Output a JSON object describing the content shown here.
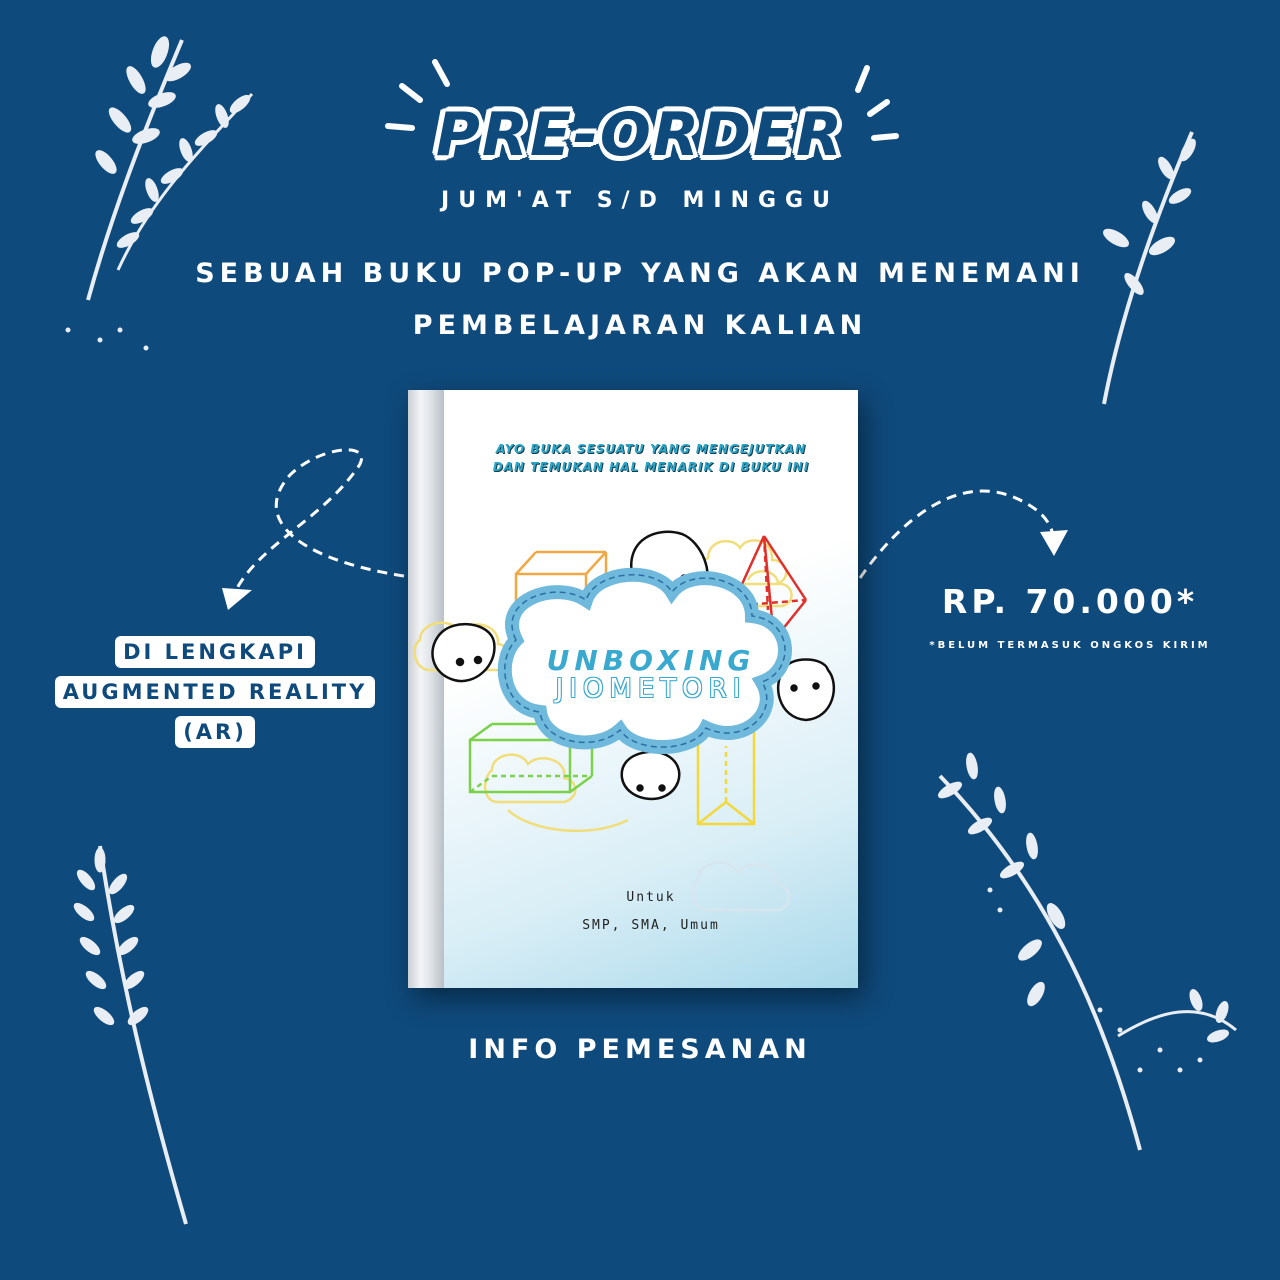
{
  "colors": {
    "background": "#0f4a7c",
    "text": "#ffffff",
    "book_accent": "#3aa9cf"
  },
  "header": {
    "title": "PRE-ORDER",
    "subtitle": "JUM'AT S/D MINGGU"
  },
  "headline": {
    "line1": "SEBUAH BUKU POP-UP YANG AKAN MENEMANI",
    "line2": "PEMBELAJARAN KALIAN"
  },
  "feature": {
    "line1": "DI LENGKAPI",
    "line2": "AUGMENTED REALITY (AR)"
  },
  "pricing": {
    "price": "RP. 70.000*",
    "note": "*BELUM TERMASUK ONGKOS KIRIM"
  },
  "book": {
    "tagline1": "AYO BUKA SESUATU YANG MENGEJUTKAN",
    "tagline2": "DAN TEMUKAN HAL MENARIK DI BUKU INI",
    "title1": "UNBOXING",
    "title2": "JIOMETORI",
    "for_label": "Untuk",
    "audience": "SMP, SMA, Umum"
  },
  "footer": {
    "info": "INFO PEMESANAN"
  },
  "icons": [
    "leaf-branch-icon",
    "dashed-arrow-icon",
    "cloud-icon",
    "cube-icon",
    "pyramid-icon",
    "cuboid-icon",
    "character-icon"
  ]
}
